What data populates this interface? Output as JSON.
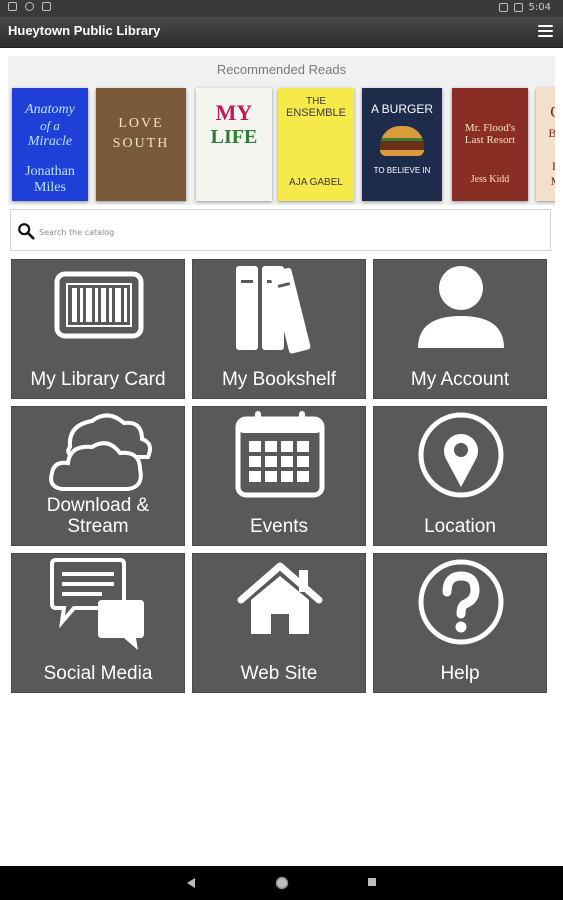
{
  "app": {
    "title": "Hueytown Public Library"
  },
  "status_bar": {
    "time": "5:04"
  },
  "recommended": {
    "title": "Recommended Reads",
    "books": [
      {
        "l1": "Anatomy",
        "l2": "of a",
        "l3": "Miracle",
        "l4": "Jonathan",
        "l5": "Miles",
        "bg": "#1f3fd8",
        "fg": "#b9e3ff"
      },
      {
        "l1": "",
        "l2": "LOVE",
        "l3": "SOUTH",
        "l4": "",
        "l5": "",
        "bg": "#7b5a3a",
        "fg": "#f3e2c2"
      },
      {
        "l1": "MY",
        "l2": "LIFE",
        "l3": "",
        "l4": "",
        "l5": "",
        "bg": "#f4f4f0",
        "fg": "#c2185b"
      },
      {
        "l1": "THE",
        "l2": "ENSEMBLE",
        "l3": "",
        "l4": "AJA GABEL",
        "l5": "",
        "bg": "#f6e94a",
        "fg": "#3b3b3b"
      },
      {
        "l1": "A BURGER",
        "l2": "",
        "l3": "",
        "l4": "TO BELIEVE IN",
        "l5": "",
        "bg": "#1d2c4b",
        "fg": "#ffffff"
      },
      {
        "l1": "Mr. Flood's",
        "l2": "Last Resort",
        "l3": "",
        "l4": "Jess Kidd",
        "l5": "",
        "bg": "#8a2e25",
        "fg": "#f4e3c3"
      },
      {
        "l1": "O",
        "l2": "BE",
        "l3": "R",
        "l4": "M",
        "l5": "",
        "bg": "#f2e0c8",
        "fg": "#7a2318"
      }
    ]
  },
  "search": {
    "placeholder": "Search the catalog"
  },
  "tiles": {
    "library_card": "My Library Card",
    "bookshelf": "My Bookshelf",
    "account": "My Account",
    "download_1": "Download &",
    "download_2": "Stream",
    "events": "Events",
    "location": "Location",
    "social": "Social Media",
    "website": "Web Site",
    "help": "Help"
  },
  "colors": {
    "tile_bg": "#595959",
    "app_bar": "#3a3a3a",
    "panel_bg": "#f1f1f1"
  }
}
